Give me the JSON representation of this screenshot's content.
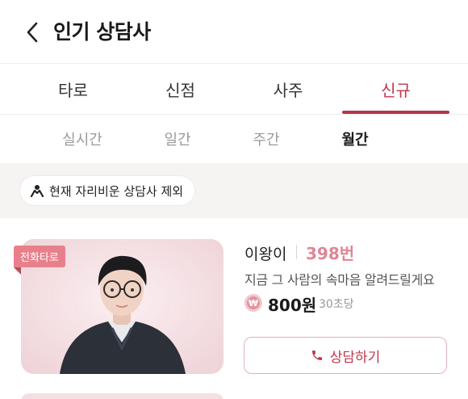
{
  "header": {
    "title": "인기 상담사",
    "back_icon": "chevron-left-icon"
  },
  "tabs": [
    {
      "label": "타로",
      "active": false
    },
    {
      "label": "신점",
      "active": false
    },
    {
      "label": "사주",
      "active": false
    },
    {
      "label": "신규",
      "active": true
    }
  ],
  "subtabs": [
    {
      "label": "실시간",
      "active": false
    },
    {
      "label": "일간",
      "active": false
    },
    {
      "label": "주간",
      "active": false
    },
    {
      "label": "월간",
      "active": true
    }
  ],
  "filter": {
    "label": "현재 자리비운 상담사 제외",
    "icon": "away-person-icon"
  },
  "counselor": {
    "badge": "전화타로",
    "name": "이왕이",
    "count": "398번",
    "description": "지금 그 사람의 속마음 알려드릴게요",
    "price": "800원",
    "unit": "30초당",
    "won_symbol": "₩",
    "button_label": "상담하기",
    "button_icon": "phone-icon"
  },
  "colors": {
    "accent": "#c0354b",
    "badge": "#e8808c",
    "count": "#e08595",
    "band": "#f6f3f3"
  }
}
